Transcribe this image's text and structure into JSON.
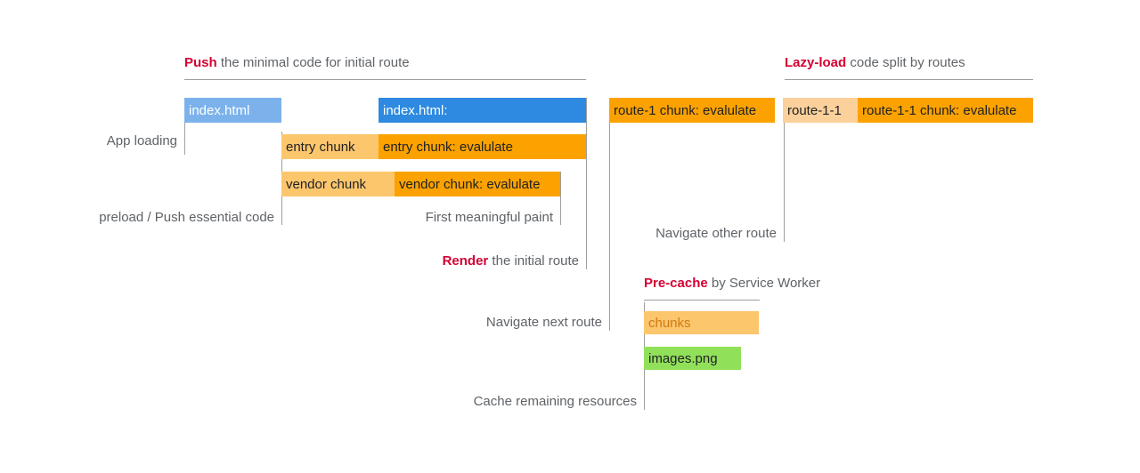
{
  "diagram": {
    "title_hidden": "",
    "sections": [
      {
        "id": "push",
        "keyword": "Push",
        "rest": " the minimal code for initial route"
      },
      {
        "id": "lazy-load",
        "keyword": "Lazy-load",
        "rest": " code split by routes"
      },
      {
        "id": "pre-cache",
        "keyword": "Pre-cache",
        "rest": " by Service Worker"
      }
    ],
    "bars": [
      {
        "id": "index-html-download",
        "label": "index.html",
        "color": "#7cb2ec",
        "text_color": "#ffffff"
      },
      {
        "id": "index-html-evaluate",
        "label": "index.html:",
        "color": "#2d8ae0",
        "text_color": "#ffffff"
      },
      {
        "id": "entry-chunk-download",
        "label": "entry chunk",
        "color": "#fcc66d",
        "text_color": "#202124"
      },
      {
        "id": "entry-chunk-evaluate",
        "label": "entry chunk: evalulate",
        "color": "#fba200",
        "text_color": "#202124"
      },
      {
        "id": "vendor-chunk-download",
        "label": "vendor chunk",
        "color": "#fcc66d",
        "text_color": "#202124"
      },
      {
        "id": "vendor-chunk-evaluate",
        "label": "vendor chunk: evalulate",
        "color": "#fba200",
        "text_color": "#202124"
      },
      {
        "id": "route-1-chunk-evaluate",
        "label": "route-1 chunk: evalulate",
        "color": "#fba200",
        "text_color": "#202124"
      },
      {
        "id": "route-1-1-download",
        "label": "route-1-1",
        "color": "#fcd09a",
        "text_color": "#202124"
      },
      {
        "id": "route-1-1-chunk-evaluate",
        "label": "route-1-1 chunk: evalulate",
        "color": "#fba200",
        "text_color": "#202124"
      },
      {
        "id": "precache-chunks",
        "label": "chunks",
        "color": "#fcc66d",
        "text_color": "#d07a10"
      },
      {
        "id": "precache-images",
        "label": "images.png",
        "color": "#91e05a",
        "text_color": "#202124"
      }
    ],
    "row_labels": [
      {
        "id": "app-loading",
        "text": "App loading"
      },
      {
        "id": "preload-push",
        "text": "preload / Push essential code"
      },
      {
        "id": "first-meaningful-paint",
        "text": "First meaningful paint"
      },
      {
        "id": "render-initial-route",
        "keyword": "Render",
        "rest": " the initial route"
      },
      {
        "id": "navigate-other-route",
        "text": "Navigate other route"
      },
      {
        "id": "navigate-next-route",
        "text": "Navigate next route"
      },
      {
        "id": "cache-remaining-resources",
        "text": "Cache remaining resources"
      }
    ],
    "colors": {
      "keyword_red": "#d50032",
      "label_gray": "#5f6368",
      "rule_gray": "#9e9e9e",
      "download_blue": "#7cb2ec",
      "evaluate_blue": "#2d8ae0",
      "download_orange": "#fcc66d",
      "evaluate_orange": "#fba200",
      "light_orange": "#fcd09a",
      "image_green": "#91e05a"
    }
  }
}
